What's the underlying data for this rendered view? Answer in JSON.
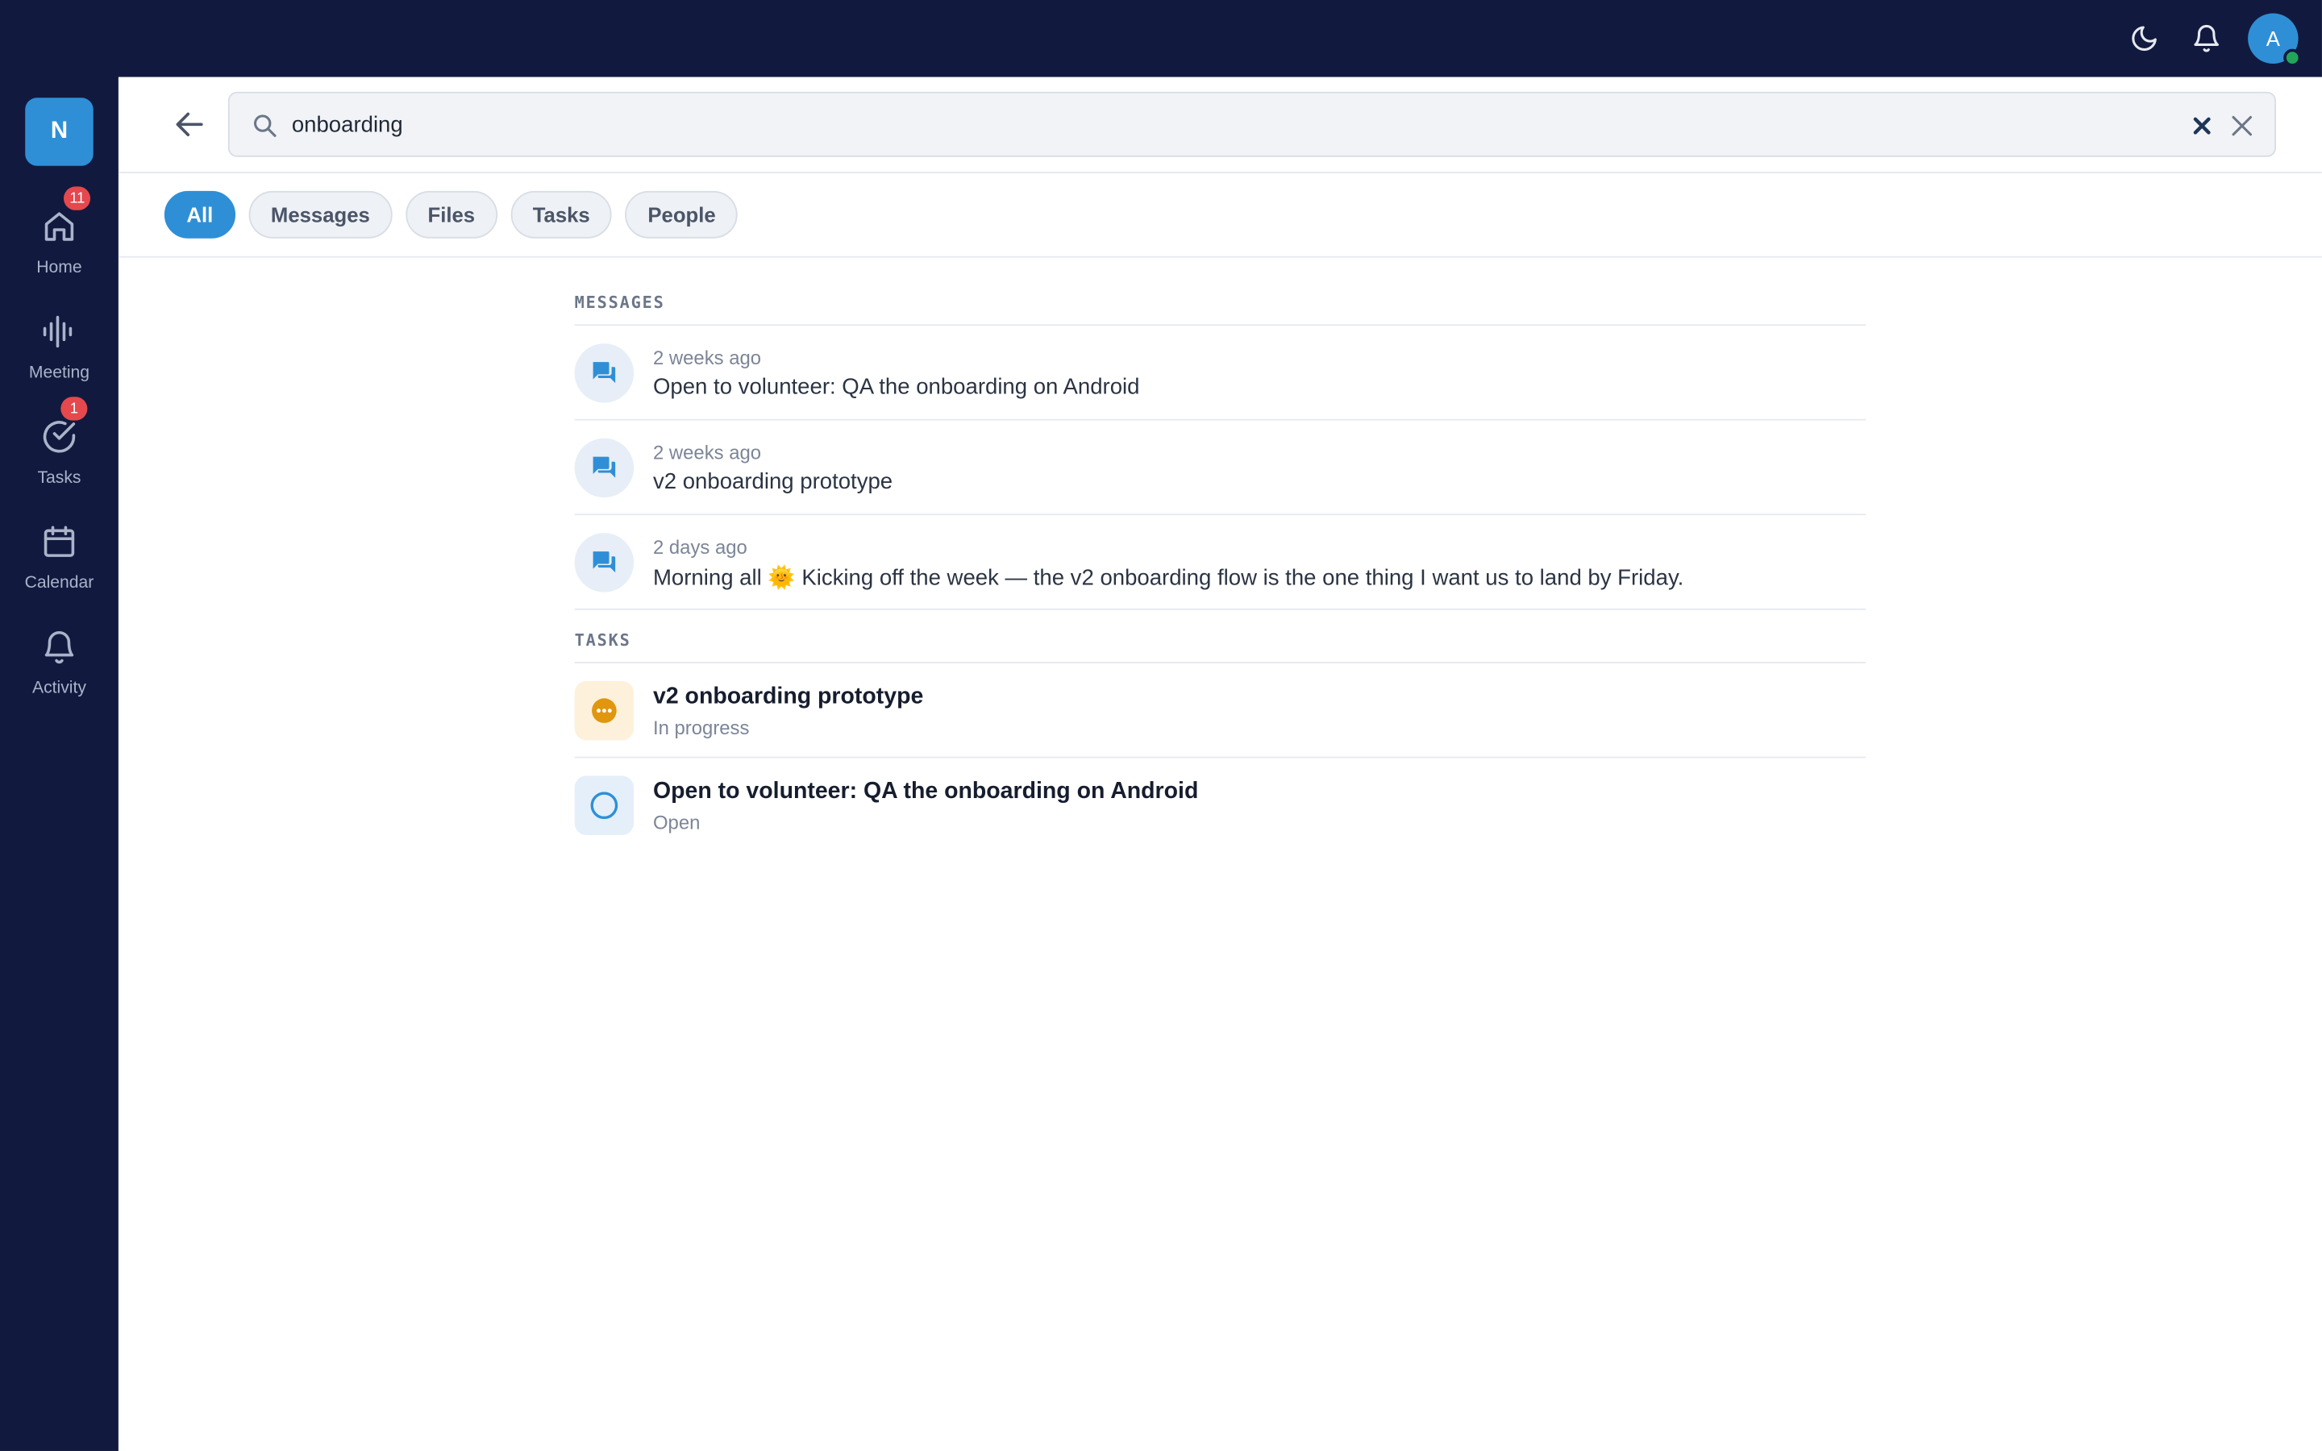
{
  "user": {
    "avatar_initial": "A"
  },
  "workspace": {
    "initial": "N"
  },
  "sidebar": {
    "items": [
      {
        "label": "Home",
        "badge": "11"
      },
      {
        "label": "Meeting",
        "badge": ""
      },
      {
        "label": "Tasks",
        "badge": "1"
      },
      {
        "label": "Calendar",
        "badge": ""
      },
      {
        "label": "Activity",
        "badge": ""
      }
    ]
  },
  "search": {
    "value": "onboarding"
  },
  "filters": [
    "All",
    "Messages",
    "Files",
    "Tasks",
    "People"
  ],
  "active_filter": "All",
  "results": {
    "messages_title": "MESSAGES",
    "messages": [
      {
        "time": "2 weeks ago",
        "text": "Open to volunteer: QA the onboarding on Android"
      },
      {
        "time": "2 weeks ago",
        "text": "v2 onboarding prototype"
      },
      {
        "time": "2 days ago",
        "text": "Morning all 🌞  Kicking off the week — the v2 onboarding flow is the one thing I want us to land by Friday."
      }
    ],
    "tasks_title": "TASKS",
    "tasks": [
      {
        "title": "v2 onboarding prototype",
        "status": "In progress"
      },
      {
        "title": "Open to volunteer: QA the onboarding on Android",
        "status": "Open"
      }
    ]
  },
  "colors": {
    "navy": "#111a3e",
    "accent": "#2f8fd6",
    "badge": "#e5484d",
    "in_progress": "#e0960e"
  }
}
